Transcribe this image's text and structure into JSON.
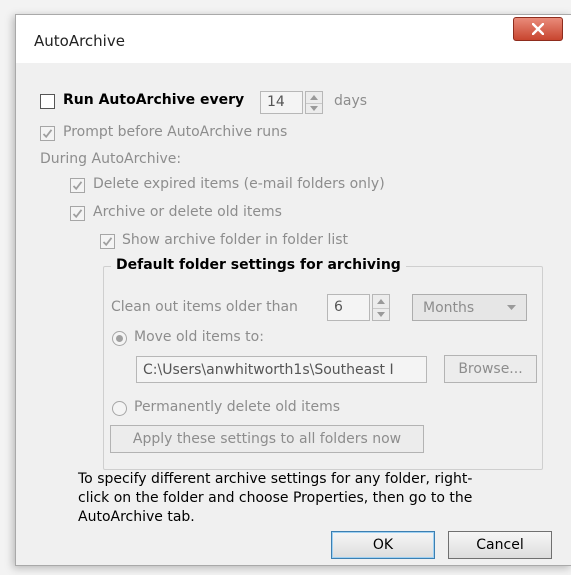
{
  "window": {
    "title": "AutoArchive"
  },
  "options": {
    "run_every_label": "Run AutoArchive every",
    "run_every_value": "14",
    "run_every_unit": "days",
    "prompt_label": "Prompt before AutoArchive runs",
    "during_label": "During AutoArchive:",
    "delete_expired_label": "Delete expired items (e-mail folders only)",
    "archive_old_label": "Archive or delete old items",
    "show_folder_label": "Show archive folder in folder list"
  },
  "defaults": {
    "group_title": "Default folder settings for archiving",
    "clean_out_label": "Clean out items older than",
    "clean_out_value": "6",
    "clean_out_unit": "Months",
    "move_label": "Move old items to:",
    "move_path": "C:\\Users\\anwhitworth1s\\Southeast I",
    "browse_label": "Browse...",
    "delete_label": "Permanently delete old items",
    "apply_label": "Apply these settings to all folders now"
  },
  "info": {
    "text": "To specify different archive settings for any folder, right-click on the folder and choose Properties, then go to the AutoArchive tab."
  },
  "buttons": {
    "ok": "OK",
    "cancel": "Cancel"
  }
}
